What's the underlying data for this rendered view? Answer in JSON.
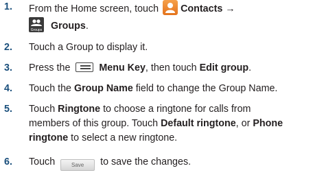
{
  "steps": [
    {
      "number": "1.",
      "prefix": "From the Home screen, touch",
      "contacts_label": "Contacts →",
      "groups_icon_label": "Groups",
      "groups_label": "Groups",
      "suffix": "."
    },
    {
      "number": "2.",
      "text": "Touch a Group to display it."
    },
    {
      "number": "3.",
      "prefix": "Press the",
      "menu_label": "Menu Key",
      "middle": ", then touch",
      "edit_label": "Edit group",
      "suffix": "."
    },
    {
      "number": "4.",
      "prefix": "Touch the",
      "field_label": "Group Name",
      "suffix": "field to change the Group Name."
    },
    {
      "number": "5.",
      "prefix": "Touch",
      "ringtone_label": "Ringtone",
      "middle1": "to choose a ringtone for calls from",
      "line2": "members of this group. Touch",
      "default_label": "Default ringtone",
      "or": ", or",
      "phone_label": "Phone",
      "line3_bold": "ringtone",
      "line3": "to select a new ringtone."
    },
    {
      "number": "6.",
      "prefix": "Touch",
      "save_label": "Save",
      "suffix": "to save the changes."
    }
  ],
  "icons": {
    "contacts": "contacts-icon",
    "groups": "groups-icon",
    "menu": "menu-key-icon"
  },
  "colors": {
    "step_number": "#1a4f7c",
    "contacts_icon": "#e4731c"
  }
}
